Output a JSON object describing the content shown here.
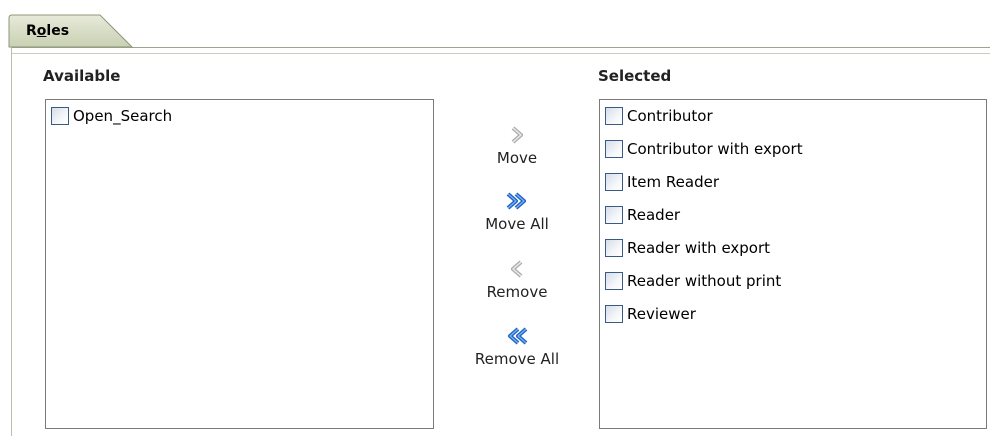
{
  "tab": {
    "label_prefix": "R",
    "label_underlined": "o",
    "label_suffix": "les"
  },
  "available": {
    "title": "Available",
    "items": [
      "Open_Search"
    ]
  },
  "selected": {
    "title": "Selected",
    "items": [
      "Contributor",
      "Contributor with export",
      "Item Reader",
      "Reader",
      "Reader with export",
      "Reader without print",
      "Reviewer"
    ]
  },
  "actions": {
    "move": "Move",
    "move_all": "Move All",
    "remove": "Remove",
    "remove_all": "Remove All"
  },
  "icons": {
    "move": "chevron-right-icon",
    "move_all": "double-chevron-right-icon",
    "remove": "chevron-left-icon",
    "remove_all": "double-chevron-left-icon"
  },
  "colors": {
    "accent_blue": "#1f63c6",
    "disabled_gray": "#a8a8a8"
  }
}
